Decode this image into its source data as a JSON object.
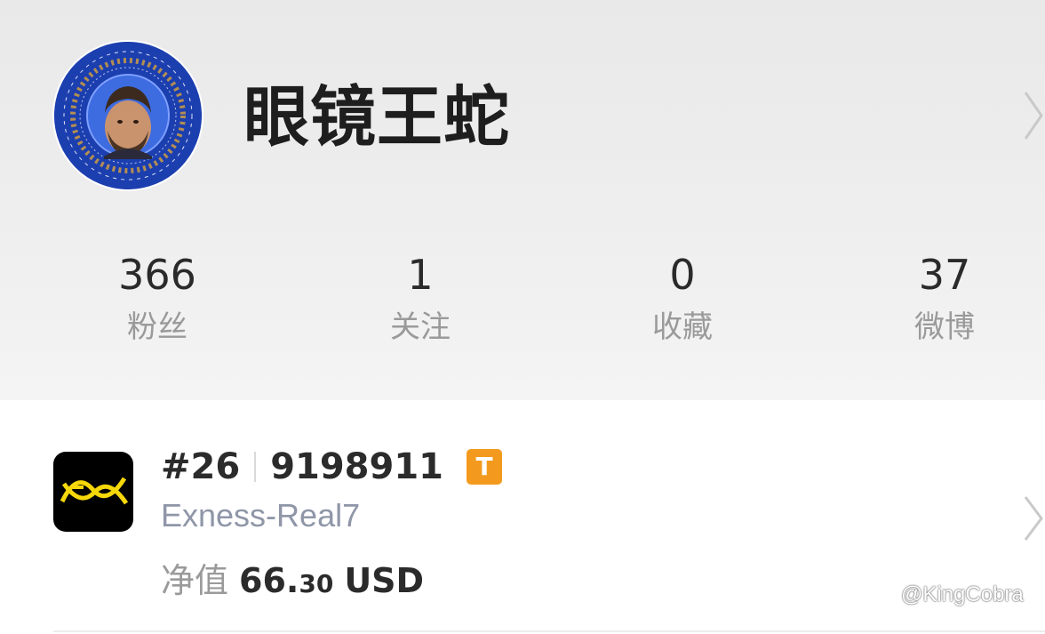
{
  "profile": {
    "username": "眼镜王蛇",
    "avatar_icon": "avatar-circle-icon",
    "stats": [
      {
        "value": "366",
        "label": "粉丝"
      },
      {
        "value": "1",
        "label": "关注"
      },
      {
        "value": "0",
        "label": "收藏"
      },
      {
        "value": "37",
        "label": "微博"
      }
    ]
  },
  "account": {
    "rank": "#26",
    "account_number": "9198911",
    "badge": "T",
    "server": "Exness-Real7",
    "equity_label": "净值",
    "equity_integer": "66.",
    "equity_decimal": "30",
    "currency": "USD",
    "broker_logo_icon": "exness-logo-icon"
  },
  "watermark": {
    "text": "@KingCobra",
    "icon": "weibo-icon"
  },
  "colors": {
    "badge": "#f39a1e",
    "server_text": "#8f96a8",
    "header_bg": "#ededed",
    "logo_yellow": "#f5d70a"
  }
}
